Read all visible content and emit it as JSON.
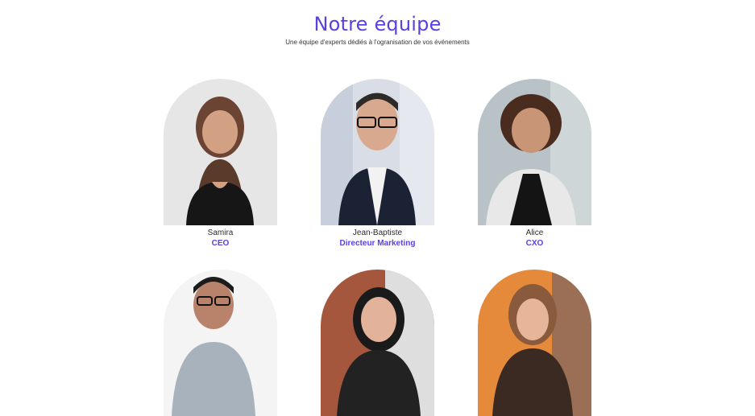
{
  "section": {
    "title": "Notre équipe",
    "subtitle": "Une équipe d'experts dédiés à l'ogranisation de vos événements"
  },
  "members": [
    {
      "name": "Samira",
      "role": "CEO"
    },
    {
      "name": "Jean-Baptiste",
      "role": "Directeur Marketing"
    },
    {
      "name": "Alice",
      "role": "CXO"
    },
    {
      "name": "",
      "role": ""
    },
    {
      "name": "",
      "role": ""
    },
    {
      "name": "",
      "role": ""
    }
  ],
  "colors": {
    "accent": "#5b3fe0",
    "text": "#2b2b2b"
  }
}
